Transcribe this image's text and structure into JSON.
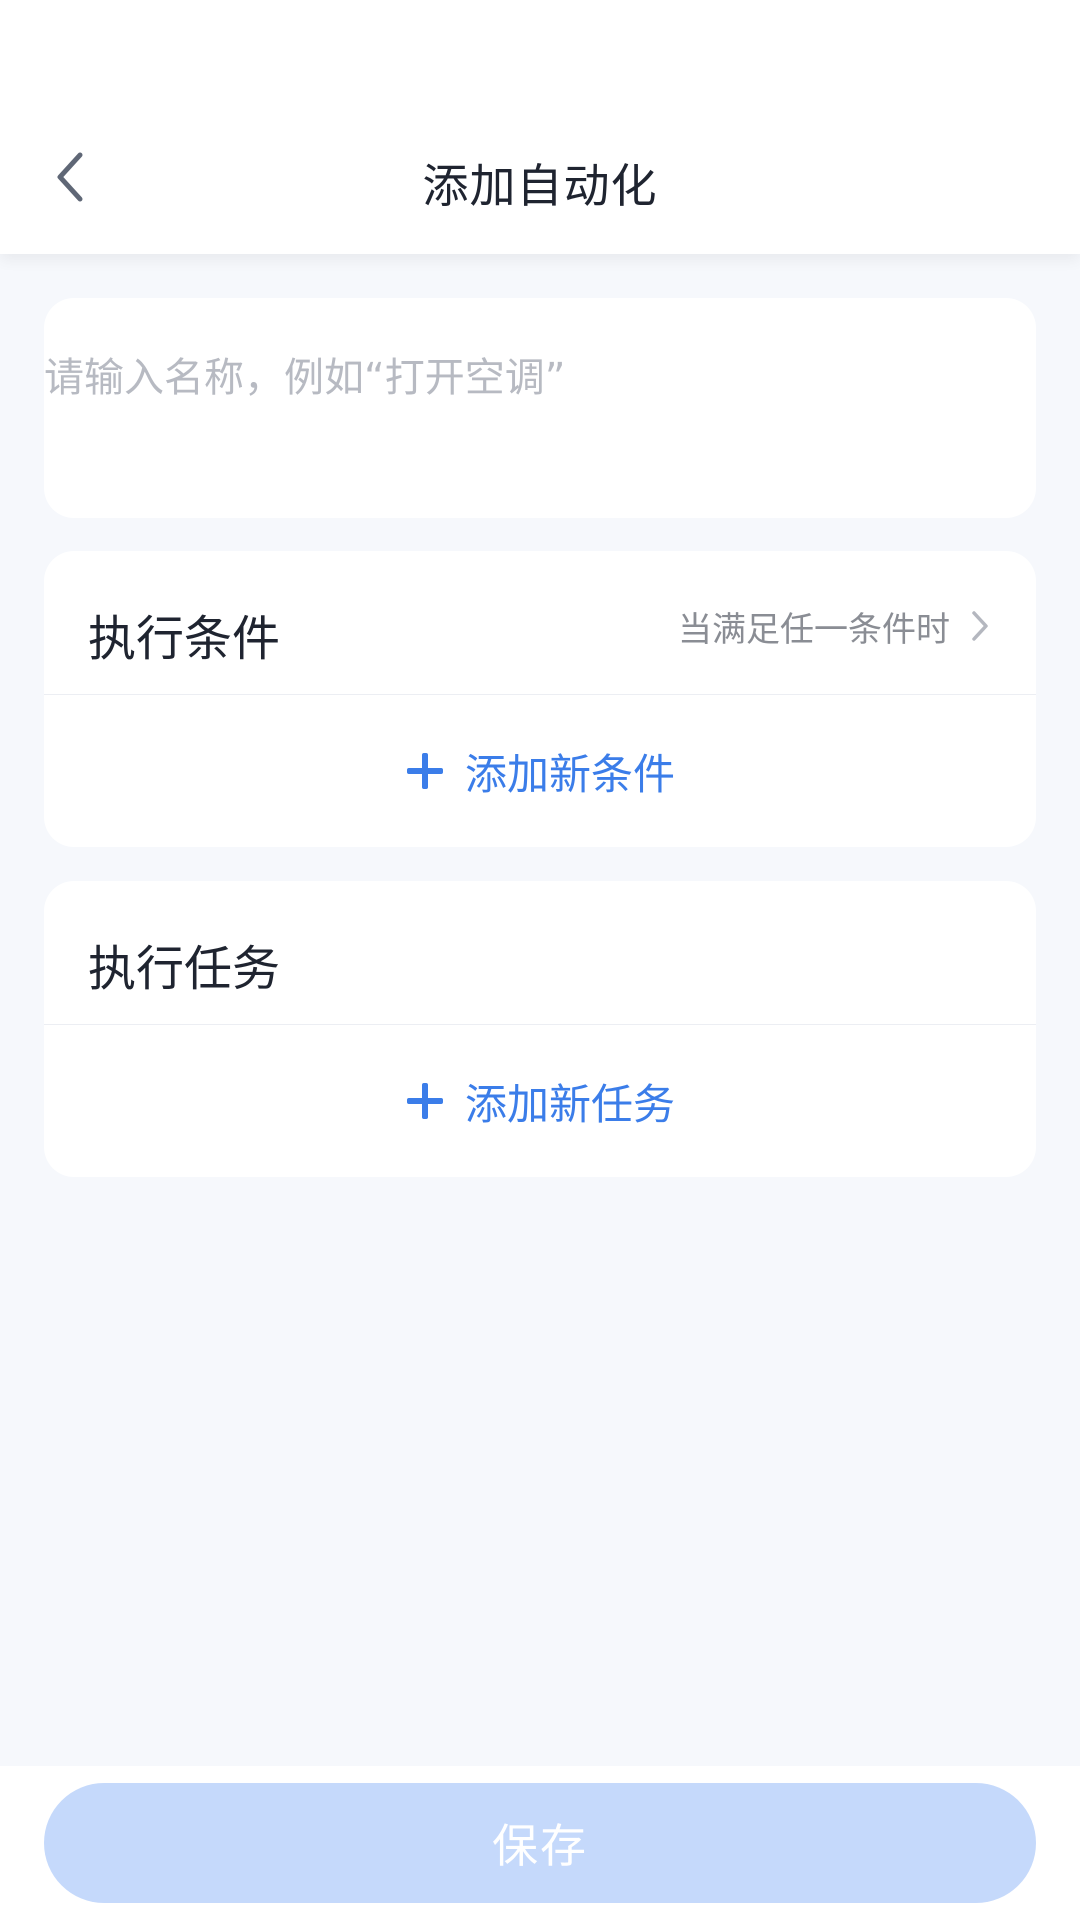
{
  "header": {
    "title": "添加自动化",
    "back_icon": "chevron-left-icon"
  },
  "name_field": {
    "value": "",
    "placeholder": "请输入名称，例如“打开空调”"
  },
  "conditions": {
    "title": "执行条件",
    "mode_label": "当满足任一条件时",
    "add_label": "添加新条件"
  },
  "tasks": {
    "title": "执行任务",
    "add_label": "添加新任务"
  },
  "footer": {
    "save_label": "保存"
  },
  "colors": {
    "accent": "#3b7de9",
    "save_disabled": "#c5d9fb",
    "background": "#f6f8fc"
  }
}
